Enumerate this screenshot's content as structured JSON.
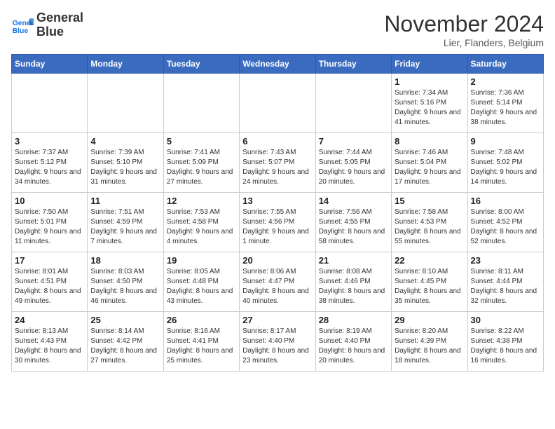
{
  "header": {
    "logo_line1": "General",
    "logo_line2": "Blue",
    "month": "November 2024",
    "location": "Lier, Flanders, Belgium"
  },
  "weekdays": [
    "Sunday",
    "Monday",
    "Tuesday",
    "Wednesday",
    "Thursday",
    "Friday",
    "Saturday"
  ],
  "weeks": [
    [
      {
        "day": "",
        "info": ""
      },
      {
        "day": "",
        "info": ""
      },
      {
        "day": "",
        "info": ""
      },
      {
        "day": "",
        "info": ""
      },
      {
        "day": "",
        "info": ""
      },
      {
        "day": "1",
        "info": "Sunrise: 7:34 AM\nSunset: 5:16 PM\nDaylight: 9 hours and 41 minutes."
      },
      {
        "day": "2",
        "info": "Sunrise: 7:36 AM\nSunset: 5:14 PM\nDaylight: 9 hours and 38 minutes."
      }
    ],
    [
      {
        "day": "3",
        "info": "Sunrise: 7:37 AM\nSunset: 5:12 PM\nDaylight: 9 hours and 34 minutes."
      },
      {
        "day": "4",
        "info": "Sunrise: 7:39 AM\nSunset: 5:10 PM\nDaylight: 9 hours and 31 minutes."
      },
      {
        "day": "5",
        "info": "Sunrise: 7:41 AM\nSunset: 5:09 PM\nDaylight: 9 hours and 27 minutes."
      },
      {
        "day": "6",
        "info": "Sunrise: 7:43 AM\nSunset: 5:07 PM\nDaylight: 9 hours and 24 minutes."
      },
      {
        "day": "7",
        "info": "Sunrise: 7:44 AM\nSunset: 5:05 PM\nDaylight: 9 hours and 20 minutes."
      },
      {
        "day": "8",
        "info": "Sunrise: 7:46 AM\nSunset: 5:04 PM\nDaylight: 9 hours and 17 minutes."
      },
      {
        "day": "9",
        "info": "Sunrise: 7:48 AM\nSunset: 5:02 PM\nDaylight: 9 hours and 14 minutes."
      }
    ],
    [
      {
        "day": "10",
        "info": "Sunrise: 7:50 AM\nSunset: 5:01 PM\nDaylight: 9 hours and 11 minutes."
      },
      {
        "day": "11",
        "info": "Sunrise: 7:51 AM\nSunset: 4:59 PM\nDaylight: 9 hours and 7 minutes."
      },
      {
        "day": "12",
        "info": "Sunrise: 7:53 AM\nSunset: 4:58 PM\nDaylight: 9 hours and 4 minutes."
      },
      {
        "day": "13",
        "info": "Sunrise: 7:55 AM\nSunset: 4:56 PM\nDaylight: 9 hours and 1 minute."
      },
      {
        "day": "14",
        "info": "Sunrise: 7:56 AM\nSunset: 4:55 PM\nDaylight: 8 hours and 58 minutes."
      },
      {
        "day": "15",
        "info": "Sunrise: 7:58 AM\nSunset: 4:53 PM\nDaylight: 8 hours and 55 minutes."
      },
      {
        "day": "16",
        "info": "Sunrise: 8:00 AM\nSunset: 4:52 PM\nDaylight: 8 hours and 52 minutes."
      }
    ],
    [
      {
        "day": "17",
        "info": "Sunrise: 8:01 AM\nSunset: 4:51 PM\nDaylight: 8 hours and 49 minutes."
      },
      {
        "day": "18",
        "info": "Sunrise: 8:03 AM\nSunset: 4:50 PM\nDaylight: 8 hours and 46 minutes."
      },
      {
        "day": "19",
        "info": "Sunrise: 8:05 AM\nSunset: 4:48 PM\nDaylight: 8 hours and 43 minutes."
      },
      {
        "day": "20",
        "info": "Sunrise: 8:06 AM\nSunset: 4:47 PM\nDaylight: 8 hours and 40 minutes."
      },
      {
        "day": "21",
        "info": "Sunrise: 8:08 AM\nSunset: 4:46 PM\nDaylight: 8 hours and 38 minutes."
      },
      {
        "day": "22",
        "info": "Sunrise: 8:10 AM\nSunset: 4:45 PM\nDaylight: 8 hours and 35 minutes."
      },
      {
        "day": "23",
        "info": "Sunrise: 8:11 AM\nSunset: 4:44 PM\nDaylight: 8 hours and 32 minutes."
      }
    ],
    [
      {
        "day": "24",
        "info": "Sunrise: 8:13 AM\nSunset: 4:43 PM\nDaylight: 8 hours and 30 minutes."
      },
      {
        "day": "25",
        "info": "Sunrise: 8:14 AM\nSunset: 4:42 PM\nDaylight: 8 hours and 27 minutes."
      },
      {
        "day": "26",
        "info": "Sunrise: 8:16 AM\nSunset: 4:41 PM\nDaylight: 8 hours and 25 minutes."
      },
      {
        "day": "27",
        "info": "Sunrise: 8:17 AM\nSunset: 4:40 PM\nDaylight: 8 hours and 23 minutes."
      },
      {
        "day": "28",
        "info": "Sunrise: 8:19 AM\nSunset: 4:40 PM\nDaylight: 8 hours and 20 minutes."
      },
      {
        "day": "29",
        "info": "Sunrise: 8:20 AM\nSunset: 4:39 PM\nDaylight: 8 hours and 18 minutes."
      },
      {
        "day": "30",
        "info": "Sunrise: 8:22 AM\nSunset: 4:38 PM\nDaylight: 8 hours and 16 minutes."
      }
    ]
  ]
}
